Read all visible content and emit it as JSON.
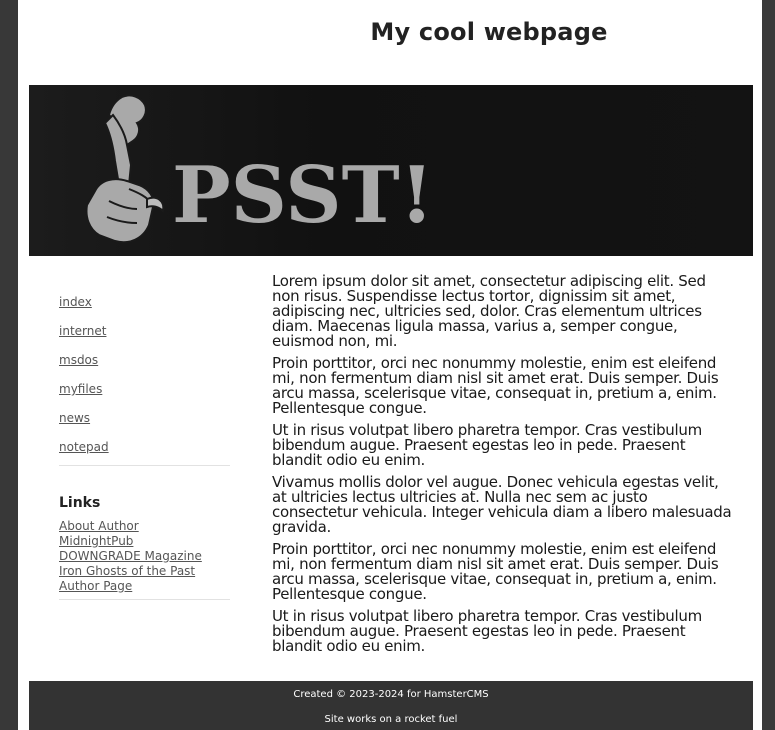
{
  "header": {
    "title": "My cool webpage"
  },
  "banner": {
    "text": "PSST!",
    "icon": "shush-hand-icon"
  },
  "sidebar": {
    "nav": [
      {
        "label": "index"
      },
      {
        "label": "internet"
      },
      {
        "label": "msdos"
      },
      {
        "label": "myfiles"
      },
      {
        "label": "news"
      },
      {
        "label": "notepad"
      }
    ],
    "links_heading": "Links",
    "links": [
      {
        "label": "About Author"
      },
      {
        "label": "MidnightPub"
      },
      {
        "label": "DOWNGRADE Magazine"
      },
      {
        "label": "Iron Ghosts of the Past"
      },
      {
        "label": "Author Page"
      }
    ]
  },
  "content": {
    "paragraphs": [
      "Lorem ipsum dolor sit amet, consectetur adipiscing elit. Sed non risus. Suspendisse lectus tortor, dignissim sit amet, adipiscing nec, ultricies sed, dolor. Cras elementum ultrices diam. Maecenas ligula massa, varius a, semper congue, euismod non, mi.",
      "Proin porttitor, orci nec nonummy molestie, enim est eleifend mi, non fermentum diam nisl sit amet erat. Duis semper. Duis arcu massa, scelerisque vitae, consequat in, pretium a, enim. Pellentesque congue.",
      "Ut in risus volutpat libero pharetra tempor. Cras vestibulum bibendum augue. Praesent egestas leo in pede. Praesent blandit odio eu enim.",
      "Vivamus mollis dolor vel augue. Donec vehicula egestas velit, at ultricies lectus ultricies at. Nulla nec sem ac justo consectetur vehicula. Integer vehicula diam a libero malesuada gravida.",
      "Proin porttitor, orci nec nonummy molestie, enim est eleifend mi, non fermentum diam nisl sit amet erat. Duis semper. Duis arcu massa, scelerisque vitae, consequat in, pretium a, enim. Pellentesque congue.",
      "Ut in risus volutpat libero pharetra tempor. Cras vestibulum bibendum augue. Praesent egestas leo in pede. Praesent blandit odio eu enim."
    ]
  },
  "footer": {
    "line1": "Created © 2023-2024 for HamsterCMS",
    "line2": "Site works on a rocket fuel"
  },
  "colors": {
    "background": "#383838",
    "page": "#ffffff",
    "banner": "#141414",
    "banner_art": "#a9a9a9",
    "footer": "#333333",
    "link": "#555555"
  }
}
